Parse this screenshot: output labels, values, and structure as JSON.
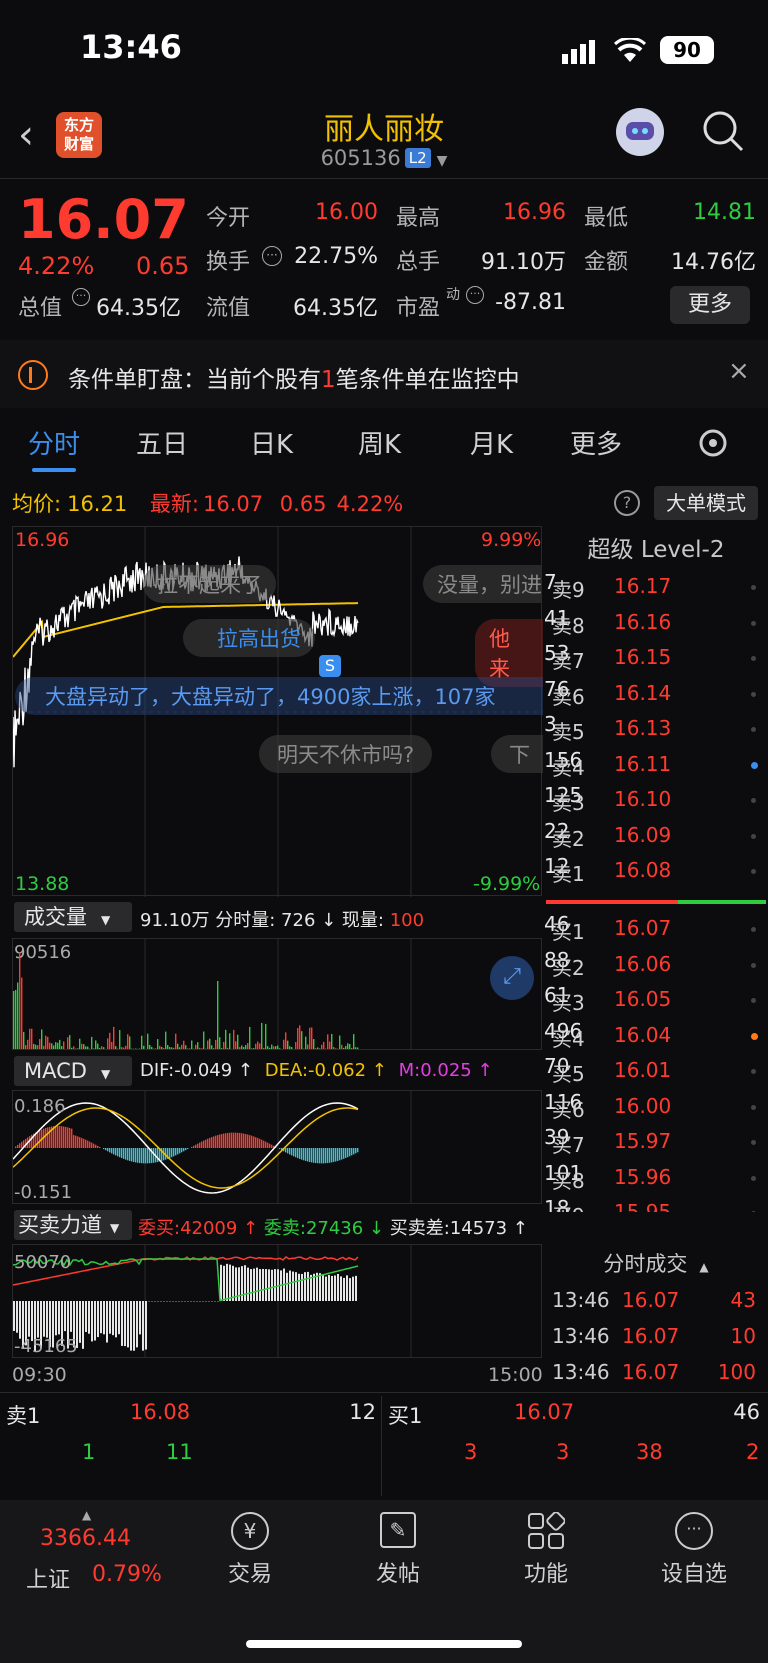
{
  "status": {
    "time": "13:46",
    "battery": "90"
  },
  "header": {
    "title": "丽人丽妆",
    "code": "605136",
    "level_badge": "L2",
    "logo": "东方\n财富"
  },
  "quote": {
    "price": "16.07",
    "pct": "4.22%",
    "chg": "0.65",
    "open_label": "今开",
    "open": "16.00",
    "high_label": "最高",
    "high": "16.96",
    "low_label": "最低",
    "low": "14.81",
    "turnover_label": "换手",
    "turnover": "22.75%",
    "volume_label": "总手",
    "volume": "91.10万",
    "amount_label": "金额",
    "amount": "14.76亿",
    "mktcap_label": "总值",
    "mktcap": "64.35亿",
    "float_label": "流值",
    "float": "64.35亿",
    "pe_label": "市盈",
    "pe_sup": "动",
    "pe": "-87.81",
    "more": "更多"
  },
  "alert": {
    "prefix": "条件单盯盘：当前个股有",
    "count": "1",
    "suffix": "笔条件单在监控中"
  },
  "tabs": [
    "分时",
    "五日",
    "日K",
    "周K",
    "月K",
    "更多"
  ],
  "intraday": {
    "avg_label": "均价:",
    "avg": "16.21",
    "latest_label": "最新:",
    "latest": "16.07",
    "chg": "0.65",
    "pct": "4.22%",
    "mode_btn": "大单模式",
    "y_top": "16.96",
    "y_bottom": "13.88",
    "pct_top": "9.99%",
    "pct_bottom": "-9.99%",
    "time_start": "09:30",
    "time_end": "15:00",
    "danmaku": [
      "拉不起来了",
      "没量，别进",
      "拉高出货",
      "他来",
      "大盘异动了，大盘异动了，4900家上涨，107家",
      "明天不休市吗?",
      "下"
    ],
    "s_marker": "S"
  },
  "volume_panel": {
    "label": "成交量",
    "total": "91.10万",
    "detail": "分时量: 726 ↓ 现量:",
    "now": "100",
    "max": "90516"
  },
  "macd_panel": {
    "label": "MACD",
    "dif": "DIF:-0.049 ↑",
    "dea": "DEA:-0.062 ↑",
    "m": "M:0.025 ↑",
    "top": "0.186",
    "bottom": "-0.151"
  },
  "force_panel": {
    "label": "买卖力道",
    "buy": "委买:42009 ↑",
    "sell": "委卖:27436 ↓",
    "diff": "买卖差:14573 ↑",
    "top": "50070",
    "bottom": "-45165"
  },
  "orderbook": {
    "title": "超级 Level-2",
    "asks": [
      {
        "label": "卖9",
        "price": "16.17",
        "qty": "7"
      },
      {
        "label": "卖8",
        "price": "16.16",
        "qty": "41"
      },
      {
        "label": "卖7",
        "price": "16.15",
        "qty": "53"
      },
      {
        "label": "卖6",
        "price": "16.14",
        "qty": "76"
      },
      {
        "label": "卖5",
        "price": "16.13",
        "qty": "3"
      },
      {
        "label": "卖4",
        "price": "16.11",
        "qty": "156"
      },
      {
        "label": "卖3",
        "price": "16.10",
        "qty": "125"
      },
      {
        "label": "卖2",
        "price": "16.09",
        "qty": "22"
      },
      {
        "label": "卖1",
        "price": "16.08",
        "qty": "12"
      }
    ],
    "bids": [
      {
        "label": "买1",
        "price": "16.07",
        "qty": "46"
      },
      {
        "label": "买2",
        "price": "16.06",
        "qty": "88"
      },
      {
        "label": "买3",
        "price": "16.05",
        "qty": "61"
      },
      {
        "label": "买4",
        "price": "16.04",
        "qty": "496"
      },
      {
        "label": "买5",
        "price": "16.01",
        "qty": "70"
      },
      {
        "label": "买6",
        "price": "16.00",
        "qty": "116"
      },
      {
        "label": "买7",
        "price": "15.97",
        "qty": "39"
      },
      {
        "label": "买8",
        "price": "15.96",
        "qty": "101"
      },
      {
        "label": "买9",
        "price": "15.95",
        "qty": "18"
      }
    ]
  },
  "ticks": {
    "title": "分时成交",
    "rows": [
      {
        "time": "13:46",
        "price": "16.07",
        "qty": "43"
      },
      {
        "time": "13:46",
        "price": "16.07",
        "qty": "10"
      },
      {
        "time": "13:46",
        "price": "16.07",
        "qty": "100"
      }
    ]
  },
  "level1": {
    "sell_label": "卖1",
    "sell_price": "16.08",
    "sell_qty": "12",
    "buy_label": "买1",
    "buy_price": "16.07",
    "buy_qty": "46",
    "sell_queue": [
      "1",
      "11"
    ],
    "buy_queue": [
      "3",
      "3",
      "38",
      "2"
    ]
  },
  "nav": {
    "index_value": "3366.44",
    "index_name": "上证",
    "index_pct": "0.79%",
    "items": [
      "交易",
      "发帖",
      "功能",
      "设自选"
    ]
  }
}
